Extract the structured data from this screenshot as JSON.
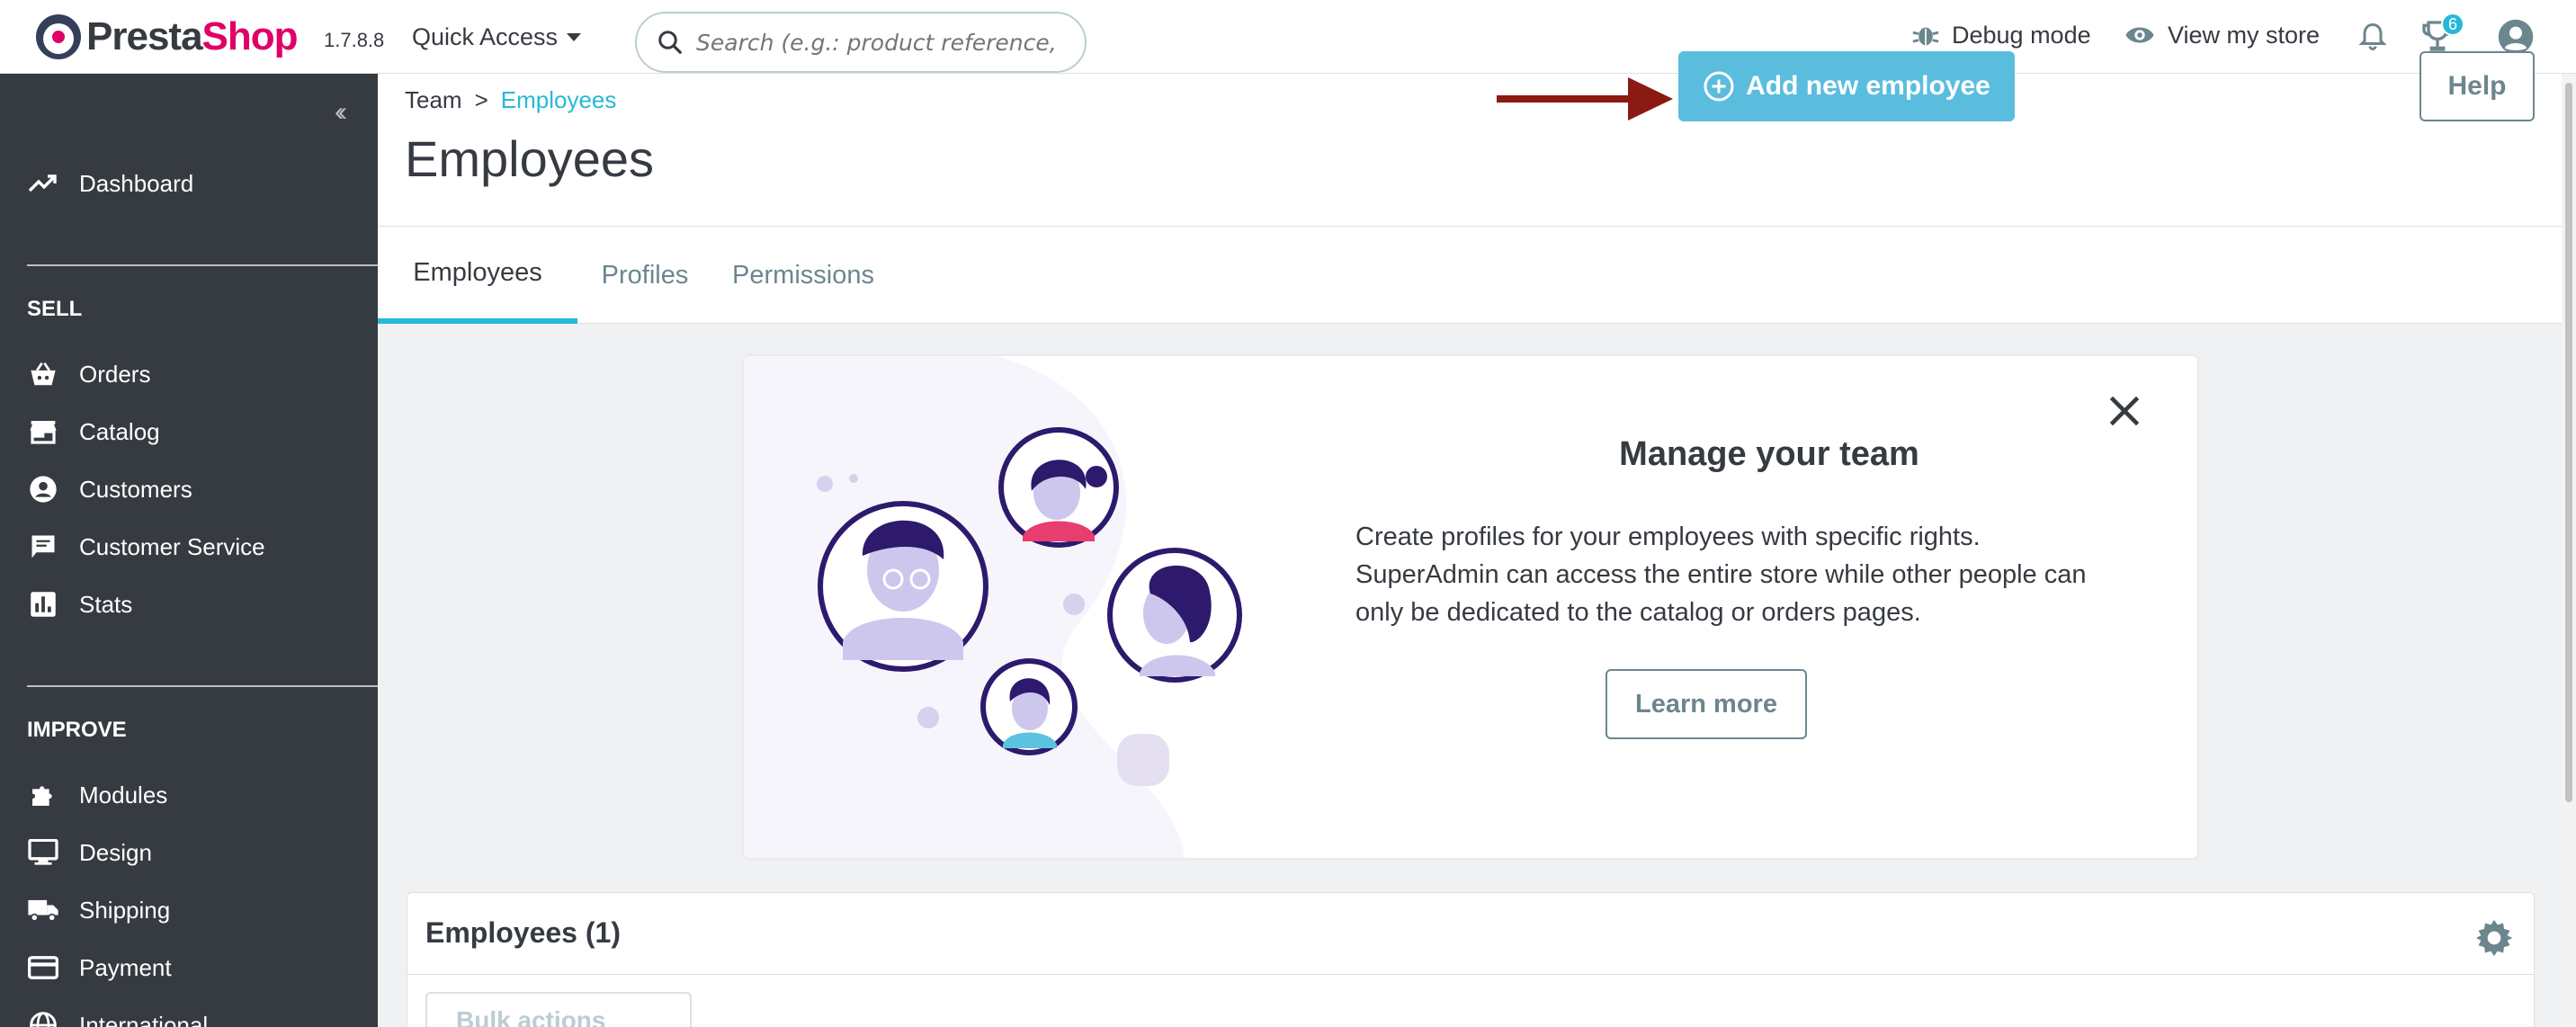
{
  "header": {
    "logo_part1": "Presta",
    "logo_part2": "Shop",
    "version": "1.7.8.8",
    "quick_access": "Quick Access",
    "search_placeholder": "Search (e.g.: product reference, custon",
    "debug_mode": "Debug mode",
    "view_store": "View my store",
    "trophy_badge": "6"
  },
  "sidebar": {
    "dashboard": "Dashboard",
    "section_sell": "SELL",
    "sell_items": [
      "Orders",
      "Catalog",
      "Customers",
      "Customer Service",
      "Stats"
    ],
    "section_improve": "IMPROVE",
    "improve_items": [
      "Modules",
      "Design",
      "Shipping",
      "Payment",
      "International"
    ]
  },
  "page": {
    "breadcrumb_parent": "Team",
    "breadcrumb_sep": ">",
    "breadcrumb_current": "Employees",
    "title": "Employees",
    "add_button": "Add new employee",
    "help_button": "Help"
  },
  "tabs": [
    "Employees",
    "Profiles",
    "Permissions"
  ],
  "card": {
    "title": "Manage your team",
    "text": "Create profiles for your employees with specific rights. SuperAdmin can access the entire store while other people can only be dedicated to the catalog or orders pages.",
    "learn_more": "Learn more"
  },
  "list": {
    "title": "Employees (1)",
    "bulk_actions": "Bulk actions"
  },
  "colors": {
    "primary": "#25b9d7",
    "button": "#5bbdde",
    "sidebar": "#363a41",
    "arrow": "#8b1a12"
  }
}
